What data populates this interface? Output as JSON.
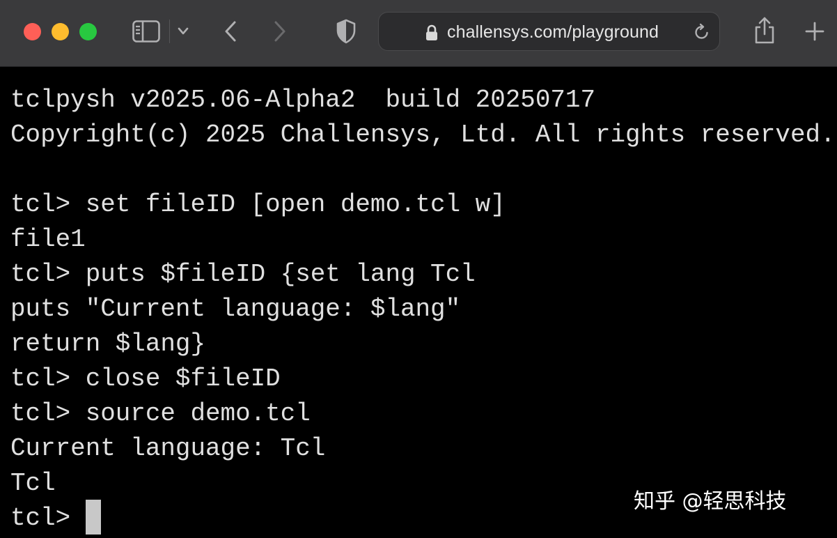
{
  "browser": {
    "url": "challensys.com/playground",
    "icons": {
      "close": "close-window-dot",
      "minimize": "minimize-window-dot",
      "maximize": "maximize-window-dot",
      "sidebar": "sidebar-icon",
      "tab_overview": "chevron-down-icon",
      "back": "chevron-left-icon",
      "forward": "chevron-right-icon",
      "privacy": "shield-icon",
      "lock": "lock-icon",
      "reload": "reload-icon",
      "share": "share-icon",
      "new_tab": "plus-icon"
    },
    "colors": {
      "toolbar_bg": "#3a3a3c",
      "close": "#fe5f57",
      "minimize": "#febc2e",
      "maximize": "#28c840"
    }
  },
  "terminal": {
    "lines": [
      "tclpysh v2025.06-Alpha2  build 20250717",
      "Copyright(c) 2025 Challensys, Ltd. All rights reserved.",
      "",
      "tcl> set fileID [open demo.tcl w]",
      "file1",
      "tcl> puts $fileID {set lang Tcl",
      "puts \"Current language: $lang\"",
      "return $lang}",
      "tcl> close $fileID",
      "tcl> source demo.tcl",
      "Current language: Tcl",
      "Tcl",
      "tcl> "
    ],
    "colors": {
      "background": "#000000",
      "text": "#e0e0e0",
      "cursor": "#c8c8c8"
    }
  },
  "watermark": "知乎 @轻思科技"
}
